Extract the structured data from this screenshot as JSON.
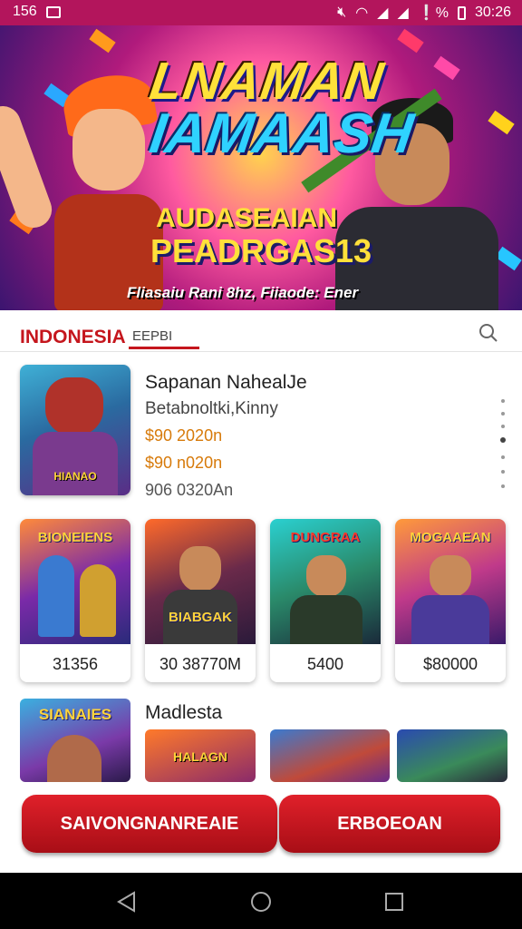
{
  "status_bar": {
    "left_text": "156",
    "battery_text": "❕%",
    "time": "30:26"
  },
  "banner": {
    "title_line1": "LNAMAN",
    "title_line2": "IAMAASH",
    "subtitle_line1": "AUDASEAIAN",
    "subtitle_line2": "PEADRGAS13",
    "tagline": "Fliasaiu Rani 8hz, Fiiaode: Ener"
  },
  "tabs": {
    "active": "INDONESIA",
    "second": "EEPBI"
  },
  "featured": {
    "title": "Sapanan NahealJe",
    "subtitle": "Betabnoltki,Kinny",
    "price_1": "$90 2020n",
    "price_2": "$90 n020n",
    "size": "906 0320An",
    "image_caption": "HIANAO"
  },
  "cards": [
    {
      "caption": "BIONEIENS",
      "value": "31356"
    },
    {
      "caption": "BIABGAK",
      "value": "30 38770M"
    },
    {
      "caption": "DUNGRAA",
      "value": "5400"
    },
    {
      "caption": "MOGAAEAN",
      "value": "$80000"
    }
  ],
  "bottom_section": {
    "label": "Madlesta",
    "first_caption": "SIANAIES",
    "second_caption": "HALAGN"
  },
  "buttons": {
    "primary": "SAIVONGNANREAIE",
    "secondary": "ERBOEOAN"
  }
}
